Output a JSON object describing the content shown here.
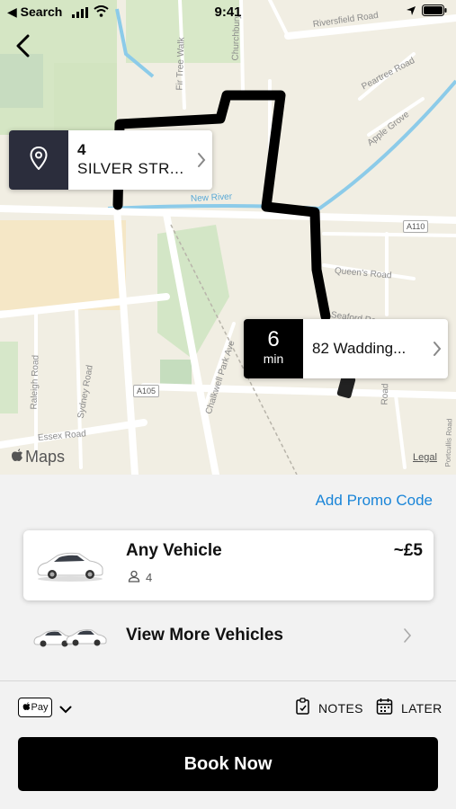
{
  "status_bar": {
    "back_app": "◀ Search",
    "time": "9:41"
  },
  "map": {
    "road_labels": [
      "Riversfield Road",
      "Peartree Road",
      "Apple Grove",
      "Fir Tree Walk",
      "Churchbury",
      "New River",
      "Queen's Road",
      "Seaford Ro",
      "Chalkwell Park Ave",
      "Raleigh Road",
      "Sydney Road",
      "Essex Road",
      "Road",
      "Portcullis Road"
    ],
    "shields": [
      "A110",
      "A105"
    ],
    "maps_logo": "Maps",
    "legal": "Legal"
  },
  "pickup": {
    "line1": "4",
    "line2": "SILVER STR..."
  },
  "dropoff": {
    "eta_value": "6",
    "eta_unit": "min",
    "address": "82 Wadding..."
  },
  "sheet": {
    "promo": "Add Promo Code",
    "vehicle": {
      "name": "Any Vehicle",
      "seats": "4",
      "price": "~£5"
    },
    "more_vehicles": "View More Vehicles",
    "payment": {
      "applepay_label": "Pay"
    },
    "notes_label": "NOTES",
    "later_label": "LATER",
    "book_label": "Book Now"
  },
  "colors": {
    "accent": "#1a85d8",
    "dark_card": "#2b2d3c",
    "button": "#000000"
  },
  "icons": [
    "back-chevron-icon",
    "location-pin-icon",
    "chevron-right-icon",
    "person-icon",
    "notes-icon",
    "calendar-icon",
    "chevron-down-icon",
    "apple-icon",
    "signal-icon",
    "wifi-icon",
    "battery-icon",
    "location-arrow-icon"
  ]
}
